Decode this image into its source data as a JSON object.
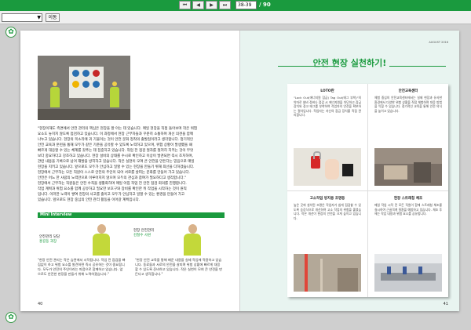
{
  "toolbar": {
    "nav": [
      "first-page",
      "prev-page",
      "next-page",
      "last-page"
    ],
    "page_input": "38-39",
    "total": "/ 90"
  },
  "selectbar": {
    "go_label": "이동"
  },
  "left_page": {
    "paragraph": [
      "\"현장이해도 측면에서 안전 관리의 핵심은 현장을 잘 아는 데 있습니다. 매일 현장을 직접 돌아보며 작은 위험",
      "요소도 놓치지 않도록 점검하고 있습니다. 이 과정에서 현장 근무자들과 꾸준히 소통하며 개선 의견을 함께",
      "나누고 있습니다. 현장의 목소리에 귀 기울이는 것이 안전 문화 정착의 출발점이라고 생각합니다. 정기적인",
      "안전 교육과 훈련을 통해 모두가 같은 기준을 공유할 수 있도록 노력하고 있으며, 위험 상황이 발생했을 때",
      "빠르게 대응할 수 있는 체계를 갖추는 데 집중하고 있습니다. 작업 전 점검 절차를 철저히 지키는 것이 무엇",
      "보다 중요하다고 강조하고 있습니다. 현장 설비의 상태를 수시로 확인하고 이상이 발견되면 즉시 조치하며,",
      "관련 내용을 기록으로 남겨 재발을 방지하고 있습니다. 작은 실천이 모여 큰 안전을 만든다는 믿음으로 매일",
      "현장을 지키고 있습니다. 앞으로도 모두가 안심하고 일할 수 있는 현장을 만들기 위해 최선을 다하겠습니다.",
      "현장에서 근무하는 모든 직원이 스스로 안전의 주인이 되어 서로를 살피는 문화를 만들어 가고 있습니다.",
      "안전은 어느 한 사람의 노력만으로 이루어지지 않으며 모두의 관심과 참여가 필요하다고 생각합니다.\"",
      "현장에서 근무하는 직원들은 안전 수칙을 생활화하며 매일 아침 작업 전 안전 점검 회의를 진행합니다.",
      "작업 계획과 위험 요소를 함께 공유하고 필요한 보호구와 장비를 확인한 뒤 작업을 시작하는 것이 원칙",
      "입니다. 이러한 노력이 쌓여 현장의 사고를 줄이고 모두가 안심하고 일할 수 있는 환경을 만들어 가고",
      "있습니다. 앞으로도 현장 중심의 안전 관리 활동을 이어갈 계획입니다."
    ],
    "interview": {
      "header": "Mini Interview",
      "person1": {
        "role": "안전관리 담당",
        "name": "홍길동 과장"
      },
      "person2": {
        "role": "현장 안전관리",
        "name": "김철수 사원"
      },
      "quote1": "\"현장 안전 관리는 작은 습관에서 시작됩니다. 작업 전 점검을 빠짐없이 하고 위험 요소를 발견하면 즉시 공유하는 것이 중요합니다. 모두가 안전의 주인이라는 마음으로 함께하고 있습니다. 앞으로도 안전한 현장을 만들기 위해 노력하겠습니다.\"",
      "quote2": "\"현장 안전 교육을 통해 배운 내용을 실제 작업에 적용하고 있습니다. 동료들과 서로의 안전을 살피며 위험 상황에 빠르게 대응할 수 있도록 준비하고 있습니다. 작은 실천이 모여 큰 안전을 만든다고 생각합니다.\""
    },
    "page_number": "40"
  },
  "right_page": {
    "small_label": "AUGUST 2016",
    "title": "안전 현장 실천하기!",
    "cells": [
      {
        "title": "LOTO란",
        "text": "\"Lock Out(에너지원 잠금) Tag Out(태그 부착)\"의 약자로 설비 정비나 점검 시 에너지원을 차단하고 잠금 장치와 경고 태그를 부착하여 작업자의 안전을 확보하는 절차입니다. 작업자는 자신의 잠금 장치를 직접 관리합니다."
      },
      {
        "title": "안전교육센터",
        "text": "체험 중심의 안전교육센터에서는 실제 현장과 유사한 환경에서 다양한 위험 상황을 직접 체험하며 대응 방법을 익힐 수 있습니다. 정기적인 교육을 통해 안전 의식을 높이고 있습니다."
      },
      {
        "title": "고소작업 방지용 조명등",
        "text": "높은 곳에 설치된 조명은 작업자가 쉽게 점검할 수 있도록 승강식으로 개선하여 고소 작업의 위험을 줄였습니다. 작은 개선이 현장의 안전을 크게 높이고 있습니다."
      },
      {
        "title": "현장 스트레칭 체조",
        "text": "매일 작업 시작 전 모든 직원이 함께 스트레칭 체조를 실시하여 근골격계 질환을 예방하고 있습니다. 체조 후에는 작업 내용과 위험 요소를 공유합니다."
      }
    ],
    "page_number": "41"
  },
  "colors": {
    "brand_green": "#1a9a3e",
    "right_page_bg": "#e8f4f0",
    "vest": "#b6d63a"
  }
}
